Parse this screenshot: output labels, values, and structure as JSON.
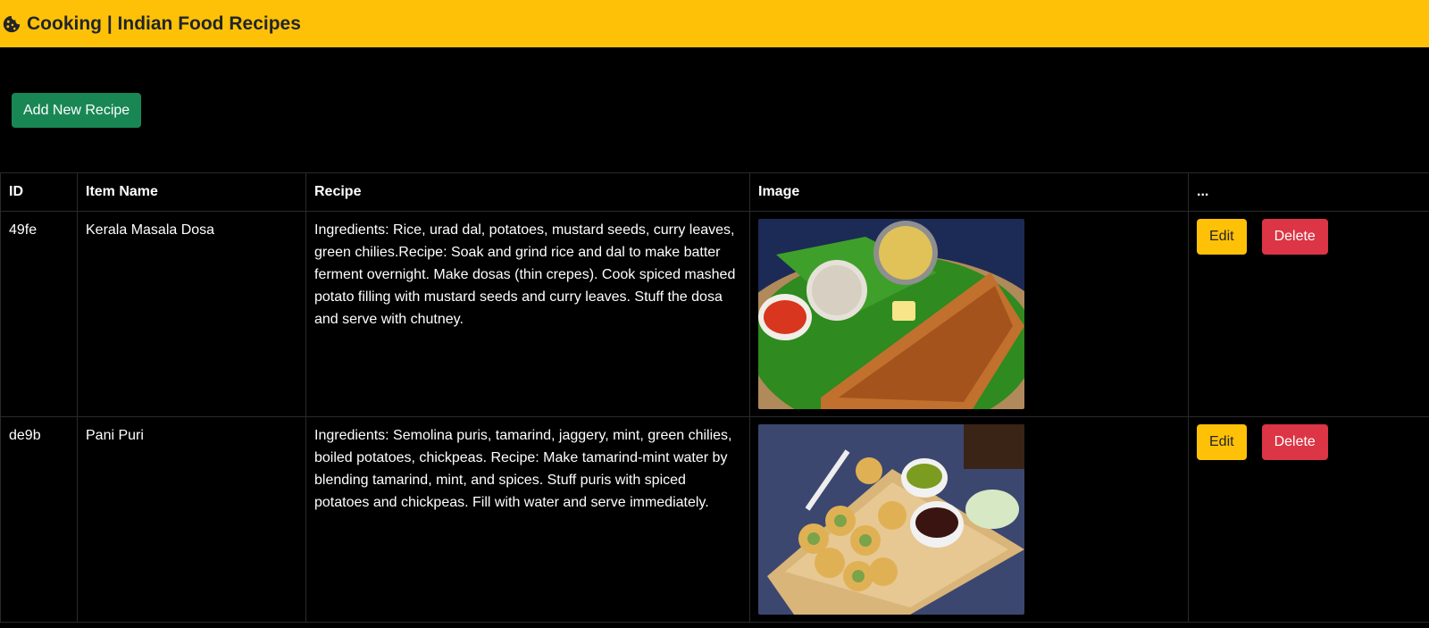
{
  "app": {
    "title": "Cooking | Indian Food Recipes",
    "accent": "#ffc107",
    "brand_icon": "cookie-icon"
  },
  "actions": {
    "add_label": "Add New Recipe"
  },
  "table": {
    "headers": [
      "ID",
      "Item Name",
      "Recipe",
      "Image",
      "..."
    ],
    "rows": [
      {
        "id": "49fe",
        "name": "Kerala Masala Dosa",
        "recipe": "Ingredients: Rice, urad dal, potatoes, mustard seeds, curry leaves, green chilies.Recipe: Soak and grind rice and dal to make batter ferment overnight. Make dosas (thin crepes). Cook spiced mashed potato filling with mustard seeds and curry leaves. Stuff the dosa and serve with chutney.",
        "edit_label": "Edit",
        "delete_label": "Delete"
      },
      {
        "id": "de9b",
        "name": "Pani Puri",
        "recipe": "Ingredients: Semolina puris, tamarind, jaggery, mint, green chilies, boiled potatoes, chickpeas. Recipe: Make tamarind-mint water by blending tamarind, mint, and spices. Stuff puris with spiced potatoes and chickpeas. Fill with water and serve immediately.",
        "edit_label": "Edit",
        "delete_label": "Delete"
      }
    ]
  }
}
